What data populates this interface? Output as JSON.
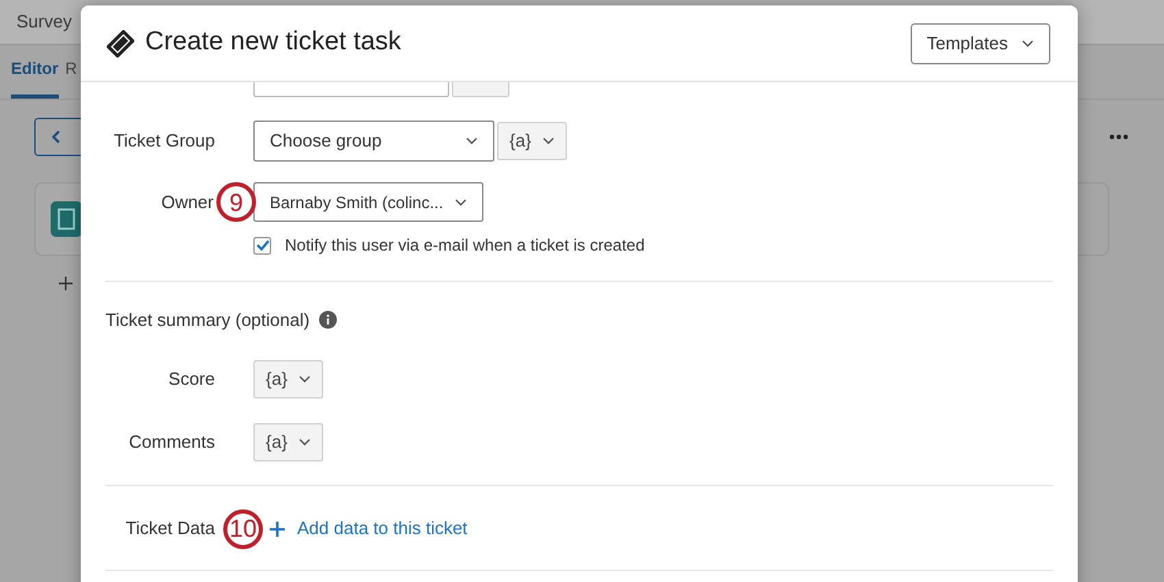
{
  "background": {
    "app_title": "Survey",
    "tabs": [
      {
        "label": "Editor",
        "selected": true
      },
      {
        "label": "R",
        "selected": false
      }
    ]
  },
  "dialog": {
    "title": "Create new ticket task",
    "templates_button": "Templates",
    "ticket_group": {
      "label": "Ticket Group",
      "value": "Choose group",
      "variable": "{a}"
    },
    "owner": {
      "label": "Owner",
      "value": "Barnaby Smith (colinc...",
      "badge": "9"
    },
    "notify": {
      "label": "Notify this user via e-mail when a ticket is created",
      "checked": true
    },
    "summary": {
      "heading": "Ticket summary (optional)",
      "fields": [
        {
          "label": "Score",
          "variable": "{a}"
        },
        {
          "label": "Comments",
          "variable": "{a}"
        }
      ]
    },
    "ticket_data": {
      "label": "Ticket Data",
      "badge": "10",
      "link": "Add data to this ticket"
    }
  }
}
